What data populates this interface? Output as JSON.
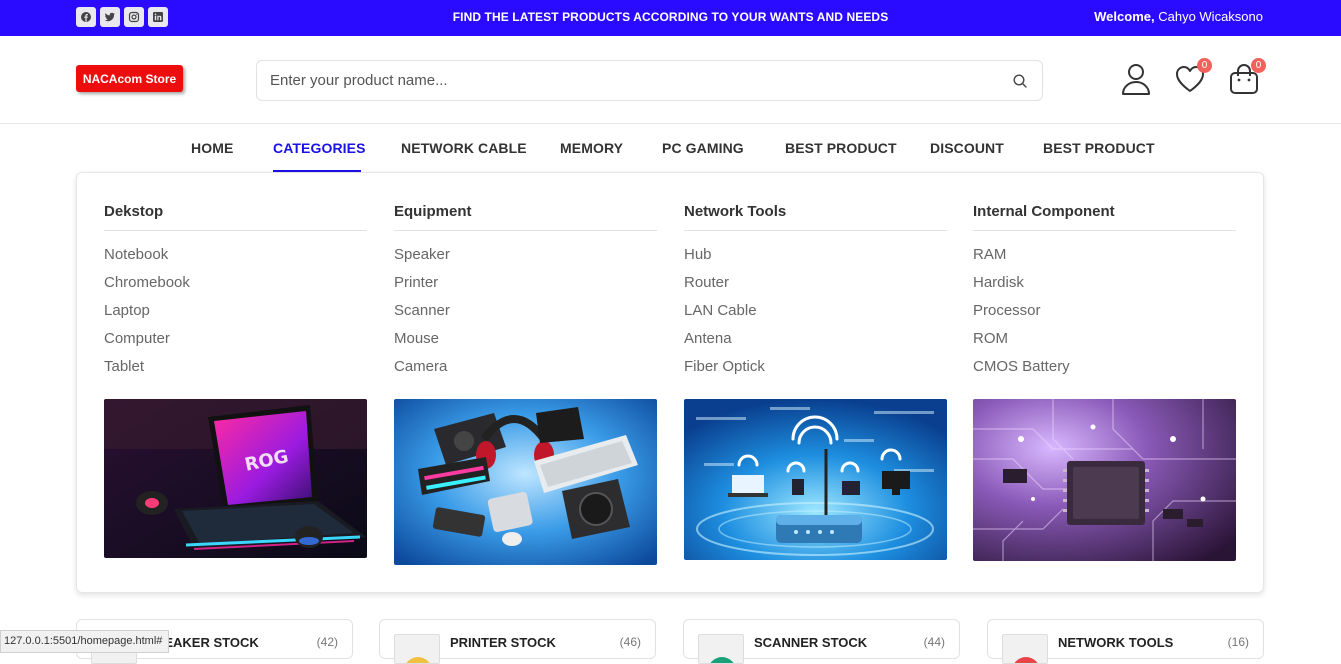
{
  "topbar": {
    "socials": [
      {
        "icon": "facebook-icon"
      },
      {
        "icon": "twitter-icon"
      },
      {
        "icon": "instagram-icon"
      },
      {
        "icon": "linkedin-icon"
      }
    ],
    "message": "FIND THE LATEST PRODUCTS ACCORDING TO YOUR WANTS AND NEEDS",
    "welcome_label": "Welcome,",
    "user_name": "Cahyo Wicaksono",
    "background": "#2a0bff"
  },
  "header": {
    "logo_text": "NACAcom Store",
    "logo_color": "#ee0d0d",
    "search_placeholder": "Enter your product name...",
    "wishlist_count": "0",
    "cart_count": "0"
  },
  "nav": {
    "items": [
      {
        "label": "HOME"
      },
      {
        "label": "CATEGORIES"
      },
      {
        "label": "NETWORK CABLE"
      },
      {
        "label": "MEMORY"
      },
      {
        "label": "PC GAMING"
      },
      {
        "label": "BEST PRODUCT"
      },
      {
        "label": "DISCOUNT"
      },
      {
        "label": "BEST PRODUCT"
      }
    ],
    "active_color": "#1a11e6"
  },
  "megamenu": {
    "columns": [
      {
        "title": "Dekstop",
        "items": [
          "Notebook",
          "Chromebook",
          "Laptop",
          "Computer",
          "Tablet"
        ],
        "image": "gaming-laptop-image"
      },
      {
        "title": "Equipment",
        "items": [
          "Speaker",
          "Printer",
          "Scanner",
          "Mouse",
          "Camera"
        ],
        "image": "pc-components-image"
      },
      {
        "title": "Network Tools",
        "items": [
          "Hub",
          "Router",
          "LAN Cable",
          "Antena",
          "Fiber Optick"
        ],
        "image": "wifi-network-image"
      },
      {
        "title": "Internal Component",
        "items": [
          "RAM",
          "Hardisk",
          "Processor",
          "ROM",
          "CMOS Battery"
        ],
        "image": "circuit-board-image"
      }
    ]
  },
  "stock_cards": [
    {
      "title": "SPEAKER STOCK",
      "count": "(42)"
    },
    {
      "title": "PRINTER STOCK",
      "count": "(46)"
    },
    {
      "title": "SCANNER STOCK",
      "count": "(44)"
    },
    {
      "title": "NETWORK TOOLS",
      "count": "(16)"
    }
  ],
  "statusbar": {
    "url": "127.0.0.1:5501/homepage.html#"
  }
}
